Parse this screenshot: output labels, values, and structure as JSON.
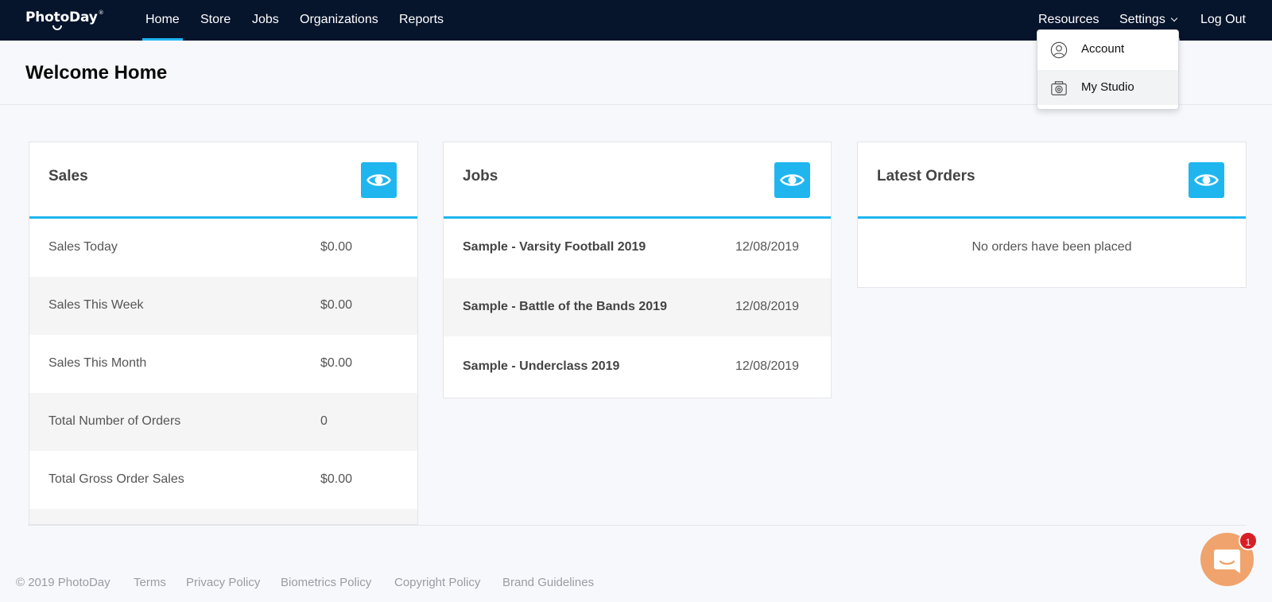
{
  "brand": {
    "name": "PhotoDay",
    "trademark": "®"
  },
  "nav": {
    "left": [
      "Home",
      "Store",
      "Jobs",
      "Organizations",
      "Reports"
    ],
    "active": "Home",
    "resources": "Resources",
    "settings": "Settings",
    "logout": "Log Out"
  },
  "settings_menu": {
    "items": [
      "Account",
      "My Studio"
    ],
    "hovered": "My Studio"
  },
  "page": {
    "title": "Welcome Home"
  },
  "sales": {
    "title": "Sales",
    "rows": [
      {
        "label": "Sales Today",
        "value": "$0.00"
      },
      {
        "label": "Sales This Week",
        "value": "$0.00"
      },
      {
        "label": "Sales This Month",
        "value": "$0.00"
      },
      {
        "label": "Total Number of Orders",
        "value": "0"
      },
      {
        "label": "Total Gross Order Sales",
        "value": "$0.00"
      }
    ]
  },
  "jobs": {
    "title": "Jobs",
    "rows": [
      {
        "name": "Sample - Varsity Football 2019",
        "date": "12/08/2019"
      },
      {
        "name": "Sample - Battle of the Bands 2019",
        "date": "12/08/2019"
      },
      {
        "name": "Sample - Underclass 2019",
        "date": "12/08/2019"
      }
    ]
  },
  "orders": {
    "title": "Latest Orders",
    "empty_message": "No orders have been placed"
  },
  "footer": {
    "copyright": "© 2019 PhotoDay",
    "links": [
      "Terms",
      "Privacy Policy",
      "Biometrics Policy",
      "Copyright Policy",
      "Brand Guidelines"
    ]
  },
  "chat": {
    "badge_count": "1"
  },
  "colors": {
    "nav_bg": "#06142c",
    "accent": "#1fb6f0",
    "chat": "#f0a36c",
    "badge": "#d81f26"
  },
  "icons": {
    "view": "eye-icon",
    "account": "user-circle-icon",
    "studio": "camera-icon",
    "chat": "chat-bubble-icon"
  }
}
